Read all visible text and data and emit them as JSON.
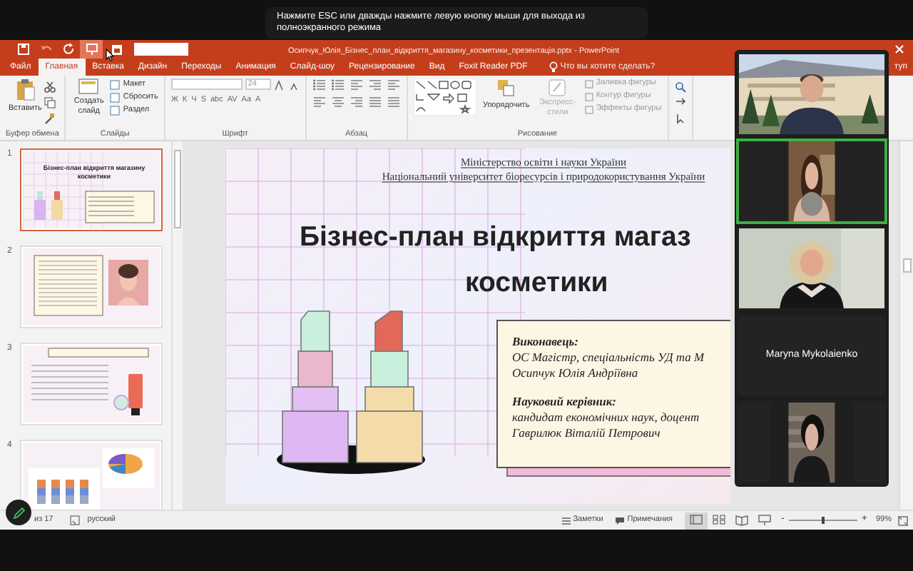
{
  "toast": {
    "text": "Нажмите ESC или дважды нажмите левую кнопку мыши для выхода из полноэкранного режима"
  },
  "window": {
    "title": "Осипчук_Юлія_Бізнес_план_відкриття_магазину_косметики_презентація.pptx - PowerPoint"
  },
  "quick_access": [
    {
      "kind": "save",
      "hovered": false
    },
    {
      "kind": "undo",
      "hovered": false
    },
    {
      "kind": "redo",
      "hovered": false
    },
    {
      "kind": "slideshow",
      "hovered": true
    }
  ],
  "tabs": [
    {
      "label": "Файл",
      "selected": false
    },
    {
      "label": "Главная",
      "selected": true
    },
    {
      "label": "Вставка",
      "selected": false
    },
    {
      "label": "Дизайн",
      "selected": false
    },
    {
      "label": "Переходы",
      "selected": false
    },
    {
      "label": "Анимация",
      "selected": false
    },
    {
      "label": "Слайд-шоу",
      "selected": false
    },
    {
      "label": "Рецензирование",
      "selected": false
    },
    {
      "label": "Вид",
      "selected": false
    },
    {
      "label": "Foxit Reader PDF",
      "selected": false
    }
  ],
  "tell_me": "Что вы хотите сделать?",
  "share_fragment": "туп",
  "ribbon": {
    "groups": [
      {
        "kind": "clipboard",
        "label": "Буфер обмена",
        "paste": "Вставить"
      },
      {
        "kind": "slides",
        "label": "Слайды",
        "new_slide": "Создать слайд",
        "items": [
          "Макет",
          "Сбросить",
          "Раздел"
        ]
      },
      {
        "kind": "font",
        "label": "Шрифт",
        "size": "24",
        "format": [
          "Ж",
          "К",
          "Ч",
          "S",
          "abc",
          "AV",
          "Aa",
          "A"
        ]
      },
      {
        "kind": "paragraph",
        "label": "Абзац"
      },
      {
        "kind": "drawing",
        "label": "Рисование",
        "arrange": "Упорядочить",
        "styles": "Экспресс-стили",
        "items": [
          "Заливка фигуры",
          "Контур фигуры",
          "Эффекты фигуры"
        ]
      },
      {
        "kind": "editing"
      }
    ]
  },
  "thumbnails": [
    {
      "number": "1",
      "selected": true,
      "kind": "title",
      "title": "Бізнес-план відкриття магазину косметики"
    },
    {
      "number": "2",
      "selected": false,
      "kind": "text_photo"
    },
    {
      "number": "3",
      "selected": false,
      "kind": "text_product"
    },
    {
      "number": "4",
      "selected": false,
      "kind": "charts"
    }
  ],
  "slide": {
    "header": [
      "Міністерство освіти і науки України",
      "Національний університет біоресурсів і природокористування України"
    ],
    "title_lines": [
      "Бізнес-план відкриття магаз",
      "косметики"
    ],
    "info": [
      {
        "kind": "heading",
        "text": "Виконавець:"
      },
      {
        "kind": "line",
        "text": "ОС Магістр, спеціальність УД та М"
      },
      {
        "kind": "line",
        "text": "Осипчук Юлія Андріївна"
      },
      {
        "kind": "heading",
        "text": "Науковий керівник:"
      },
      {
        "kind": "line",
        "text": "кандидат економічних наук, доцент"
      },
      {
        "kind": "line",
        "text": "Гаврилюк Віталій Петрович"
      }
    ]
  },
  "participants": [
    {
      "kind": "outdoor",
      "active": false
    },
    {
      "kind": "room",
      "active": true
    },
    {
      "kind": "office",
      "active": false
    },
    {
      "kind": "name",
      "name": "Maryna Mykolaienko",
      "active": false
    },
    {
      "kind": "stairs",
      "active": false
    }
  ],
  "status_bar": {
    "slide_counter": "из 17",
    "language": "русский",
    "notes": "Заметки",
    "comments": "Примечания",
    "views": [
      {
        "kind": "normal",
        "selected": true
      },
      {
        "kind": "sorter",
        "selected": false
      },
      {
        "kind": "reading",
        "selected": false
      },
      {
        "kind": "show",
        "selected": false
      }
    ],
    "zoom_out": "-",
    "zoom_in": "+",
    "zoom": {
      "level": 0.5
    },
    "zoom_value": "99%"
  }
}
